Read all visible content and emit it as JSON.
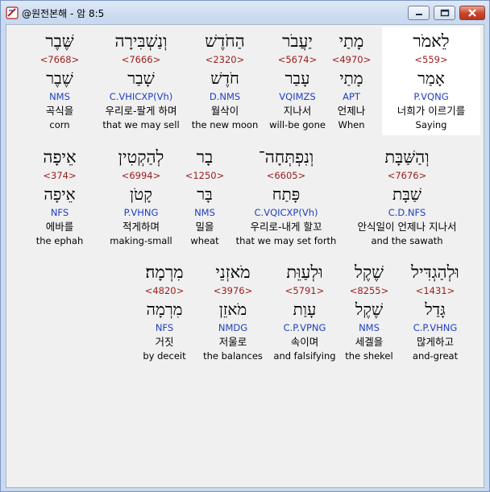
{
  "window": {
    "title": "@원전본해 - 암 8:5"
  },
  "icons": {
    "app": "hebrew-bible-app-icon",
    "minimize": "minimize-icon",
    "maximize": "maximize-icon",
    "close": "close-icon"
  },
  "rows": [
    {
      "words": [
        {
          "heb": "לֵאמֹר",
          "strong": "<559>",
          "lex": "אָמַר",
          "parse": "P.VQNG",
          "kor": "너희가 이르기를",
          "eng": "Saying",
          "highlight": true
        },
        {
          "heb": "מָתַי",
          "strong": "<4970>",
          "lex": "מָתַי",
          "parse": "APT",
          "kor": "언제나",
          "eng": "When"
        },
        {
          "heb": "יַעֲבֹר",
          "strong": "<5674>",
          "lex": "עָבַר",
          "parse": "VQIMZS",
          "kor": "지나서",
          "eng": "will-be gone"
        },
        {
          "heb": "הַחֹדֶשׁ",
          "strong": "<2320>",
          "lex": "חֹדֶשׁ",
          "parse": "D.NMS",
          "kor": "월삭이",
          "eng": "the new moon"
        },
        {
          "heb": "וְנַשְׁבִּירָה",
          "strong": "<7666>",
          "lex": "שָׁבַר",
          "parse": "C.VHICXP(Vh)",
          "kor": "우리로-팔게 하며",
          "eng": "that we may sell"
        },
        {
          "heb": "שֶּׁבֶר",
          "strong": "<7668>",
          "lex": "שֶׁבֶר",
          "parse": "NMS",
          "kor": "곡식을",
          "eng": "corn"
        }
      ]
    },
    {
      "words": [
        {
          "heb": "וְהַשַּׁבָּת",
          "strong": "<7676>",
          "lex": "שַׁבָּת",
          "parse": "C.D.NFS",
          "kor": "안식일이 언제나 지나서",
          "eng": "and the sawath"
        },
        {
          "heb": "וְנִפְתְּחָה־",
          "strong": "<6605>",
          "lex": "פָּתַח",
          "parse": "C.VQICXP(Vh)",
          "kor": "우리로-내게 할꼬",
          "eng": "that we may set forth"
        },
        {
          "heb": "בָר",
          "strong": "<1250>",
          "lex": "בָּר",
          "parse": "NMS",
          "kor": "밀을",
          "eng": "wheat"
        },
        {
          "heb": "לְהַקְטִין",
          "strong": "<6994>",
          "lex": "קָטֹן",
          "parse": "P.VHNG",
          "kor": "적게하며",
          "eng": "making-small"
        },
        {
          "heb": "אֵיפָה",
          "strong": "<374>",
          "lex": "אֵיפָה",
          "parse": "NFS",
          "kor": "에바를",
          "eng": "the ephah"
        }
      ]
    },
    {
      "words": [
        {
          "heb": "וּלְהַגְדִּיל",
          "strong": "<1431>",
          "lex": "גָּדַל",
          "parse": "C.P.VHNG",
          "kor": "많게하고",
          "eng": "and-great"
        },
        {
          "heb": "שֶׁקֶל",
          "strong": "<8255>",
          "lex": "שֶׁקֶל",
          "parse": "NMS",
          "kor": "세겔을",
          "eng": "the shekel"
        },
        {
          "heb": "וּלְעַוֵּת",
          "strong": "<5791>",
          "lex": "עָוַת",
          "parse": "C.P.VPNG",
          "kor": "속이며",
          "eng": "and falsifying"
        },
        {
          "heb": "מֹאזְנֵי",
          "strong": "<3976>",
          "lex": "מֹאזֵן",
          "parse": "NMDG",
          "kor": "저울로",
          "eng": "the balances"
        },
        {
          "heb": "מִרְמָה׃",
          "strong": "<4820>",
          "lex": "מִרְמָה",
          "parse": "NFS",
          "kor": "거짓",
          "eng": "by deceit"
        }
      ]
    }
  ]
}
